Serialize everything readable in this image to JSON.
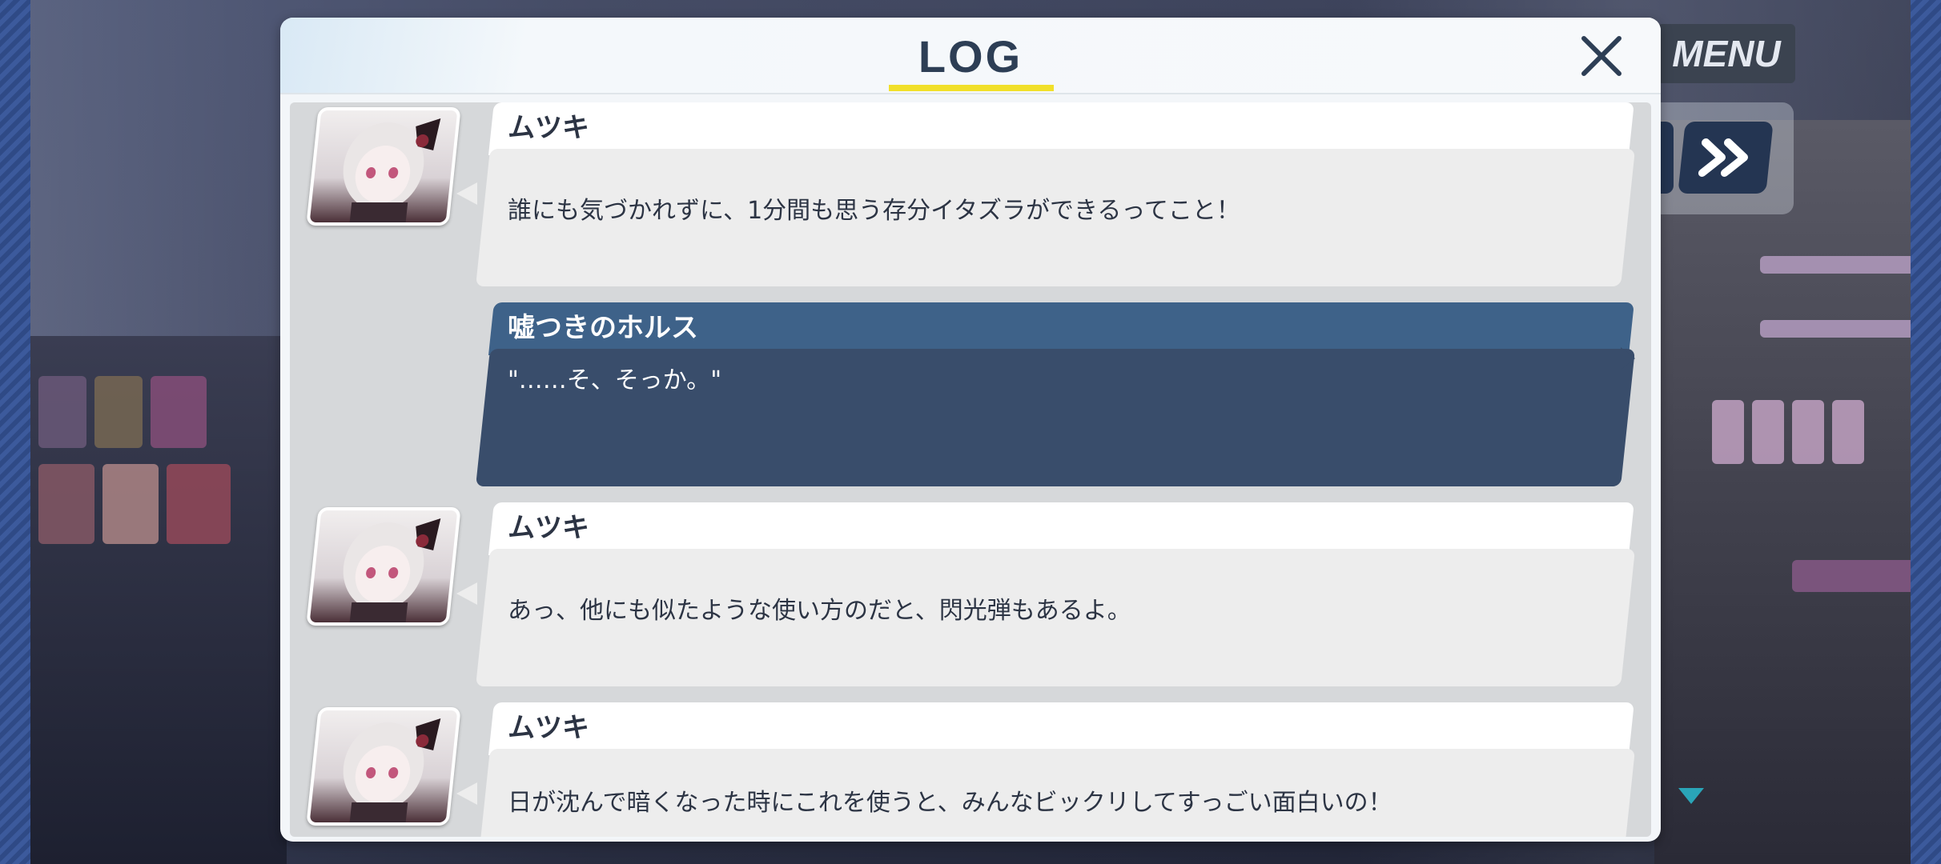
{
  "window": {
    "title": "LOG",
    "accent_color": "#f1e02a",
    "title_color": "#2d3e55"
  },
  "controls": {
    "menu_label": "MENU",
    "skip_icon": "double-chevron-right-icon",
    "close_icon": "close-icon",
    "scroll_icon": "scroll-down-triangle-icon"
  },
  "log": {
    "entries": [
      {
        "speaker": "ムツキ",
        "type": "character",
        "text": "誰にも気づかれずに、1分間も思う存分イタズラができるってこと！"
      },
      {
        "speaker": "嘘つきのホルス",
        "type": "player",
        "text": "\"……そ、そっか。\""
      },
      {
        "speaker": "ムツキ",
        "type": "character",
        "text": "あっ、他にも似たような使い方のだと、閃光弾もあるよ。"
      },
      {
        "speaker": "ムツキ",
        "type": "character",
        "text": "日が沈んで暗くなった時にこれを使うと、みんなビックリしてすっごい面白いの！"
      }
    ]
  }
}
